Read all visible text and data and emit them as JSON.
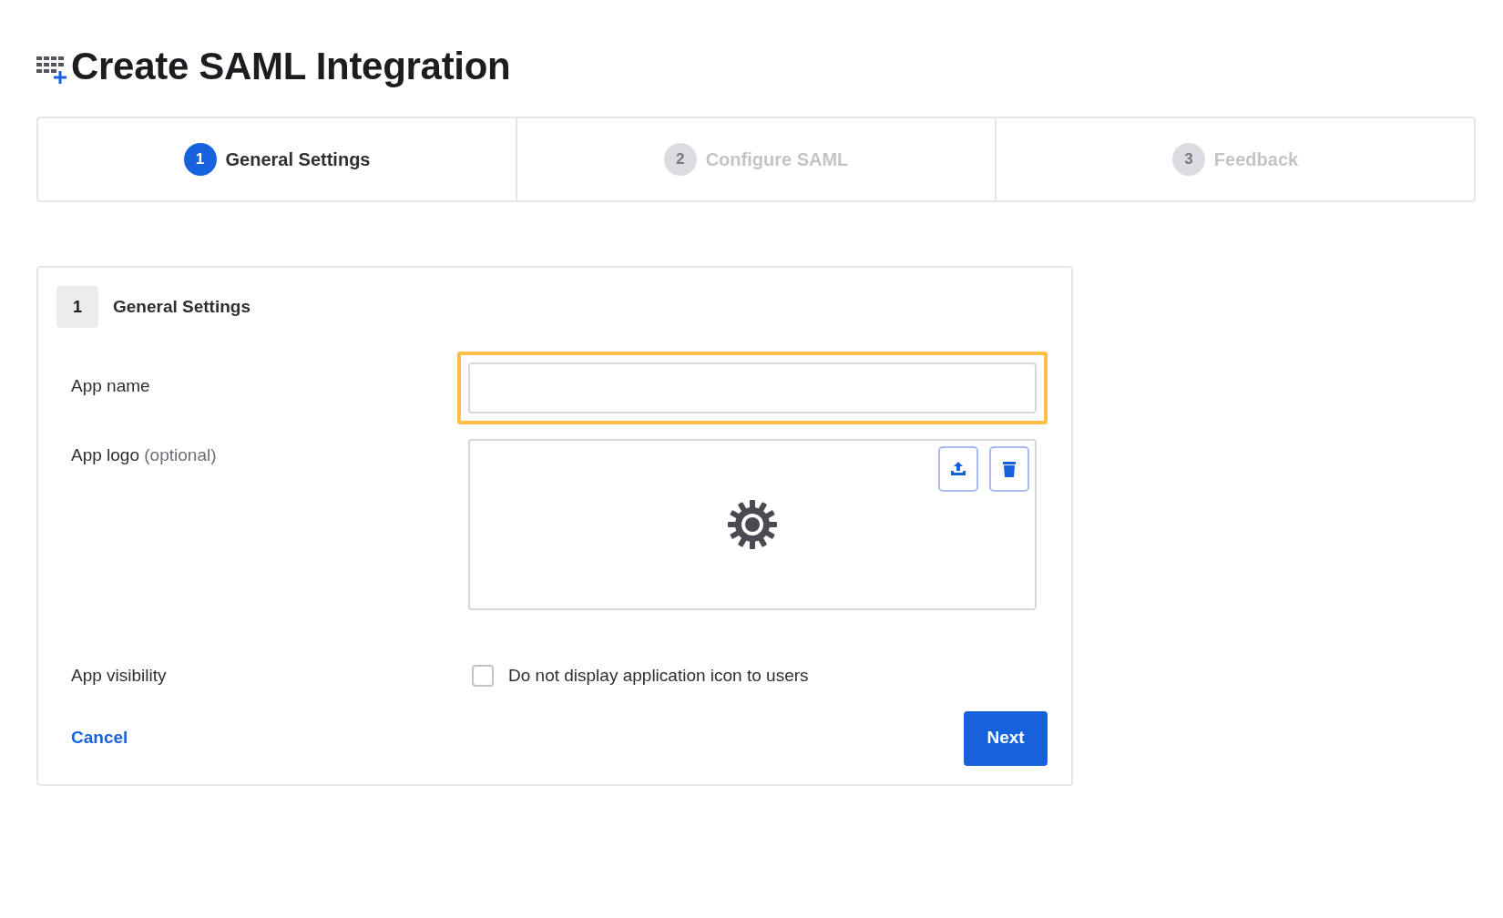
{
  "page": {
    "title": "Create SAML Integration"
  },
  "steps": [
    {
      "number": "1",
      "label": "General Settings",
      "selected": true
    },
    {
      "number": "2",
      "label": "Configure SAML",
      "selected": false
    },
    {
      "number": "3",
      "label": "Feedback",
      "selected": false
    }
  ],
  "section": {
    "number": "1",
    "title": "General Settings"
  },
  "app_name": {
    "label": "App name",
    "focused": true
  },
  "app_logo": {
    "label": "App logo",
    "hint": "(optional)"
  },
  "app_visibility": {
    "label": "App visibility",
    "checkbox_label": "Do not display application icon to users",
    "checked": false
  },
  "actions": {
    "cancel": "Cancel",
    "next": "Next"
  }
}
